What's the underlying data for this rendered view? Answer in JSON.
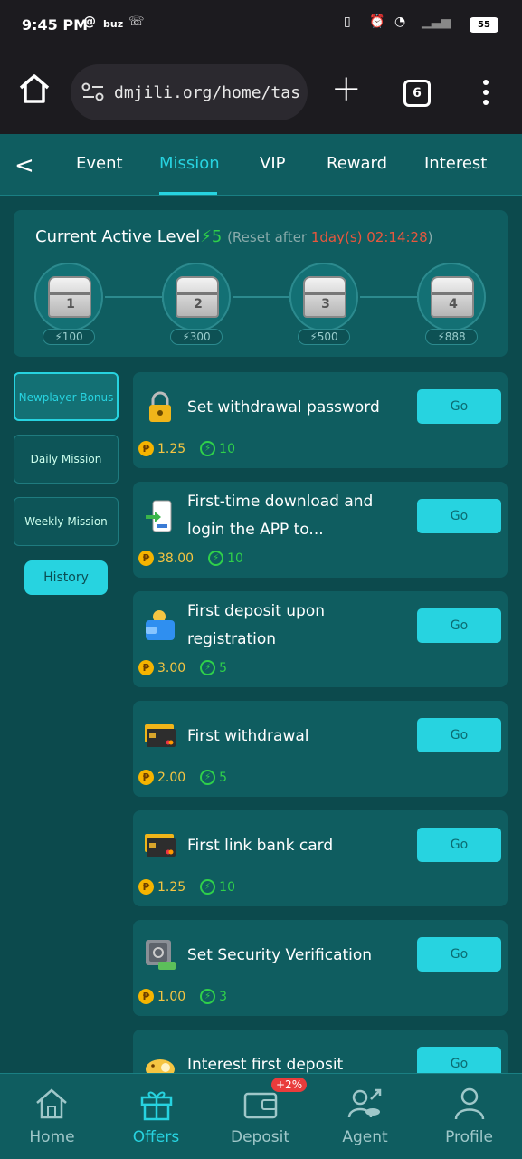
{
  "status": {
    "time": "9:45 PM",
    "carrier": "buz",
    "battery": "55"
  },
  "browser": {
    "url": "dmjili.org/home/task?:",
    "tab_count": "6",
    "new_tab": "+"
  },
  "topnav": {
    "tabs": [
      {
        "label": "Event"
      },
      {
        "label": "Mission"
      },
      {
        "label": "VIP"
      },
      {
        "label": "Reward"
      },
      {
        "label": "Interest"
      }
    ],
    "active": "Mission"
  },
  "level": {
    "title": "Current Active Level",
    "level_value": "5",
    "reset_prefix": "(Reset after ",
    "countdown": "1day(s) 02:14:28",
    "reset_suffix": ")",
    "chests": [
      {
        "num": "1",
        "points": "100"
      },
      {
        "num": "2",
        "points": "300"
      },
      {
        "num": "3",
        "points": "500"
      },
      {
        "num": "4",
        "points": "888"
      }
    ]
  },
  "sidebar": {
    "items": [
      {
        "label": "Newplayer Bonus"
      },
      {
        "label": "Daily Mission"
      },
      {
        "label": "Weekly Mission"
      }
    ],
    "history": "History"
  },
  "missions": [
    {
      "name": "Set withdrawal password",
      "amount": "1.25",
      "points": "10",
      "go": "Go",
      "icon": "lock-icon"
    },
    {
      "name": "First-time download and login the APP to...",
      "amount": "38.00",
      "points": "10",
      "go": "Go",
      "icon": "phone-download-icon"
    },
    {
      "name": "First deposit upon registration",
      "amount": "3.00",
      "points": "5",
      "go": "Go",
      "icon": "wallet-icon"
    },
    {
      "name": "First withdrawal",
      "amount": "2.00",
      "points": "5",
      "go": "Go",
      "icon": "bank-card-icon"
    },
    {
      "name": "First link bank card",
      "amount": "1.25",
      "points": "10",
      "go": "Go",
      "icon": "bank-card-icon"
    },
    {
      "name": "Set Security Verification",
      "amount": "1.00",
      "points": "3",
      "go": "Go",
      "icon": "safe-icon"
    },
    {
      "name": "Interest first deposit",
      "go": "Go",
      "icon": "piggy-bank-icon"
    }
  ],
  "bottomnav": {
    "items": [
      {
        "label": "Home",
        "icon": "home-icon"
      },
      {
        "label": "Offers",
        "icon": "gift-icon"
      },
      {
        "label": "Deposit",
        "icon": "wallet-icon"
      },
      {
        "label": "Agent",
        "icon": "agent-icon"
      },
      {
        "label": "Profile",
        "icon": "profile-icon"
      }
    ],
    "deposit_badge": "+2%",
    "active": "Offers"
  },
  "colors": {
    "accent": "#27d3e0",
    "panel": "#0f5d60",
    "background": "#0c4a4d",
    "points_green": "#2fd04a",
    "coin_gold": "#f5b400",
    "countdown_red": "#e8573d"
  }
}
